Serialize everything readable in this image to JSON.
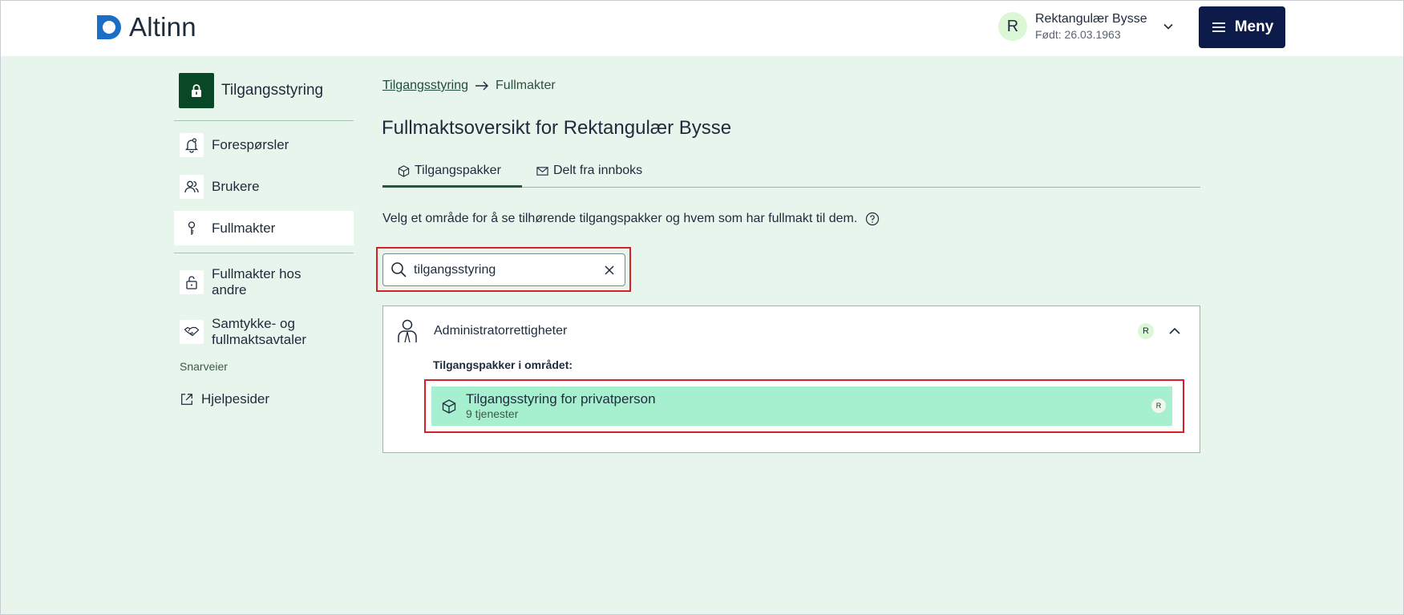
{
  "header": {
    "app_name": "Altinn",
    "user": {
      "initial": "R",
      "name": "Rektangulær Bysse",
      "dob": "Født: 26.03.1963"
    },
    "menu_label": "Meny"
  },
  "sidebar": {
    "title": "Tilgangsstyring",
    "items": [
      {
        "label": "Forespørsler",
        "icon": "bell-icon"
      },
      {
        "label": "Brukere",
        "icon": "users-icon"
      },
      {
        "label": "Fullmakter",
        "icon": "key-icon",
        "active": true
      },
      {
        "label": "Fullmakter hos andre",
        "icon": "padlock-open-icon"
      },
      {
        "label": "Samtykke- og fullmaktsavtaler",
        "icon": "handshake-icon"
      }
    ],
    "shortcuts_label": "Snarveier",
    "help_label": "Hjelpesider"
  },
  "breadcrumb": {
    "parent": "Tilgangsstyring",
    "current": "Fullmakter"
  },
  "page_title": "Fullmaktsoversikt for Rektangulær Bysse",
  "tabs": [
    {
      "label": "Tilgangspakker",
      "icon": "package-icon",
      "active": true
    },
    {
      "label": "Delt fra innboks",
      "icon": "envelope-icon",
      "active": false
    }
  ],
  "description": "Velg et område for å se tilhørende tilgangspakker og hvem som har fullmakt til dem.",
  "search": {
    "value": "tilgangsstyring"
  },
  "area": {
    "title": "Administratorrettigheter",
    "badge": "R",
    "packages_label": "Tilgangspakker i området:",
    "packages": [
      {
        "title": "Tilgangsstyring for privatperson",
        "subtitle": "9 tjenester",
        "badge": "R"
      }
    ]
  },
  "colors": {
    "page_bg": "#e8f5ec",
    "menu_button": "#0d1b4a",
    "sidebar_icon_bg": "#084827",
    "package_highlight": "#a6f0d0",
    "annotation_box": "#d91f26"
  }
}
